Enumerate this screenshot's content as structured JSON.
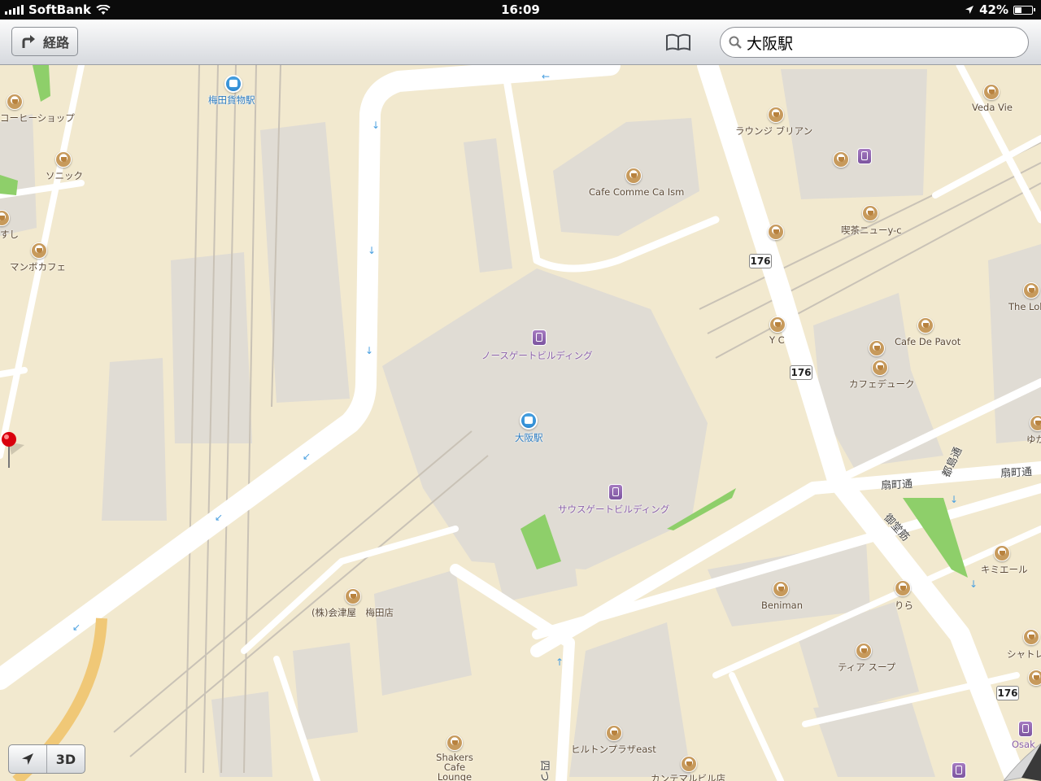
{
  "status_bar": {
    "carrier": "SoftBank",
    "time": "16:09",
    "battery": "42%",
    "battery_level": 0.42
  },
  "toolbar": {
    "route_label": "経路",
    "search_value": "大阪駅"
  },
  "map": {
    "pois": [
      {
        "label": "コーヒーショップ",
        "type": "cafe"
      },
      {
        "label": "ソニック",
        "type": "cafe"
      },
      {
        "label": "すし",
        "type": "cafe"
      },
      {
        "label": "マンボカフェ",
        "type": "cafe"
      },
      {
        "label": "梅田貨物駅",
        "type": "station"
      },
      {
        "label": "ラウンジ ブリアン",
        "type": "cafe"
      },
      {
        "label": "Veda Vie",
        "type": "cafe"
      },
      {
        "label": "Cafe Comme Ca Ism",
        "type": "cafe"
      },
      {
        "label": "喫茶ニューy-c",
        "type": "cafe"
      },
      {
        "label": "The Lob",
        "type": "cafe"
      },
      {
        "label": "Y C",
        "type": "cafe"
      },
      {
        "label": "Cafe De Pavot",
        "type": "cafe"
      },
      {
        "label": "カフェデューク",
        "type": "cafe"
      },
      {
        "label": "ゆか",
        "type": "cafe"
      },
      {
        "label": "ノースゲートビルディング",
        "type": "train"
      },
      {
        "label": "大阪駅",
        "type": "station"
      },
      {
        "label": "サウスゲートビルディング",
        "type": "train"
      },
      {
        "label": "キミエール",
        "type": "cafe"
      },
      {
        "label": "Beniman",
        "type": "cafe"
      },
      {
        "label": "りら",
        "type": "cafe"
      },
      {
        "label": "シャトレ",
        "type": "cafe"
      },
      {
        "label": "(株)会津屋　梅田店",
        "type": "cafe"
      },
      {
        "label": "ティア スープ",
        "type": "cafe"
      },
      {
        "label": "ヒルトンプラザeast",
        "type": "cafe"
      },
      {
        "label": "Shakers Cafe Lounge",
        "type": "cafe"
      },
      {
        "label": "カンテマルビル店",
        "type": "cafe"
      },
      {
        "label": "Osak",
        "type": "train"
      }
    ],
    "streets": [
      "扇町通",
      "扇町通",
      "御堂筋",
      "都島通",
      "四つ"
    ],
    "route_shields": [
      "176",
      "176",
      "176"
    ]
  },
  "controls": {
    "btn_3d": "3D"
  }
}
